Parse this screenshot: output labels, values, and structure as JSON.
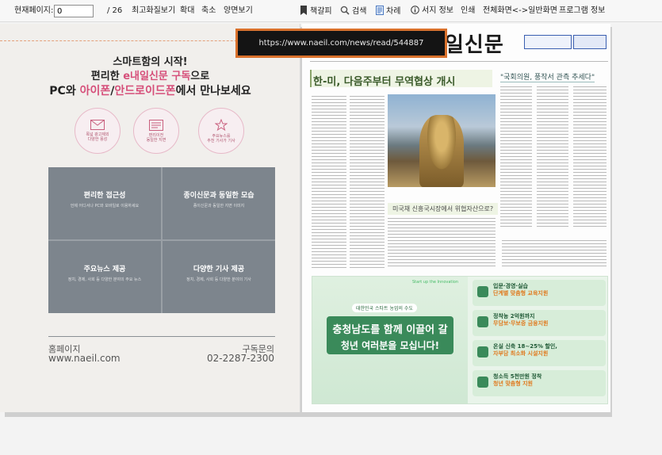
{
  "toolbar": {
    "page_label": "현재페이지:",
    "page_value": "0",
    "page_total": "/ 26",
    "fit_label": "최고화질보기",
    "zoom_in_label": "확대",
    "zoom_out_label": "축소",
    "spread_label": "양면보기",
    "bookmark_label": "책갈피",
    "search_label": "검색",
    "toc_label": "차례",
    "info_label": "서지 정보",
    "print_label": "인쇄",
    "fullscreen_label": "전체화면<->일반화면",
    "program_info_label": "프로그램 정보"
  },
  "url_popup": {
    "url": "https://www.naeil.com/news/read/544887"
  },
  "left_page": {
    "title1": "스마트함의 시작!",
    "title2_a": "편리한 ",
    "title2_b": "e내일신문 구독",
    "title2_c": "으로",
    "title3_a": "PC와 ",
    "title3_b": "아이폰",
    "title3_c": "/",
    "title3_d": "안드로이드폰",
    "title3_e": "에서 만나보세요",
    "icon_caption_1": "폭넓 광고제외\n다양한 풍성",
    "icon_caption_2": "편리이전\n동일한 지면",
    "icon_caption_3": "주요뉴스를\n추천 기사가 기사",
    "features": [
      {
        "title": "편리한 접근성",
        "sub": "언제 어디서나 PC와 모바일로 이용하세요"
      },
      {
        "title": "종이신문과 동일한 모습",
        "sub": "종이신문과 동일한 지면 이미지"
      },
      {
        "title": "주요뉴스 제공",
        "sub": "정치, 경제, 사회 등 다양한 분야의 주요 뉴스"
      },
      {
        "title": "다양한 기사 제공",
        "sub": "정치, 경제, 사회 등 다양한 분야의 기사"
      }
    ],
    "homepage_label": "홈페이지",
    "homepage_url": "www.naeil.com",
    "subscribe_label": "구독문의",
    "subscribe_phone": "02-2287-2300"
  },
  "right_page": {
    "masthead": "일신문",
    "headline": "한-미, 다음주부터 무역협상 개시",
    "side_headline": "\"국회의원, 풍작서 관측 추세다\"",
    "mid_headline": "미국채 신흥국시장에서 위협자산으로?",
    "ad": {
      "tag": "대한민국 스타트 농업의 수도",
      "banner_line1": "충청남도를 함께 이끌어 갈",
      "banner_line2": "청년 여러분을 모십니다!",
      "start_label": "Start up the Innovation",
      "rows": [
        {
          "text": "입문·경영·실습",
          "hi": "단계별 맞춤형 교육지원"
        },
        {
          "text": "정착농 2억원까지",
          "hi": "무담보·무보증 금융지원"
        },
        {
          "text": "온실 신축 18~25% 할인,",
          "hi": "자부담 최소화 시설지원"
        },
        {
          "text": "청소득 5천만원 정착",
          "hi": "청년 맞춤형 지원"
        }
      ]
    }
  }
}
